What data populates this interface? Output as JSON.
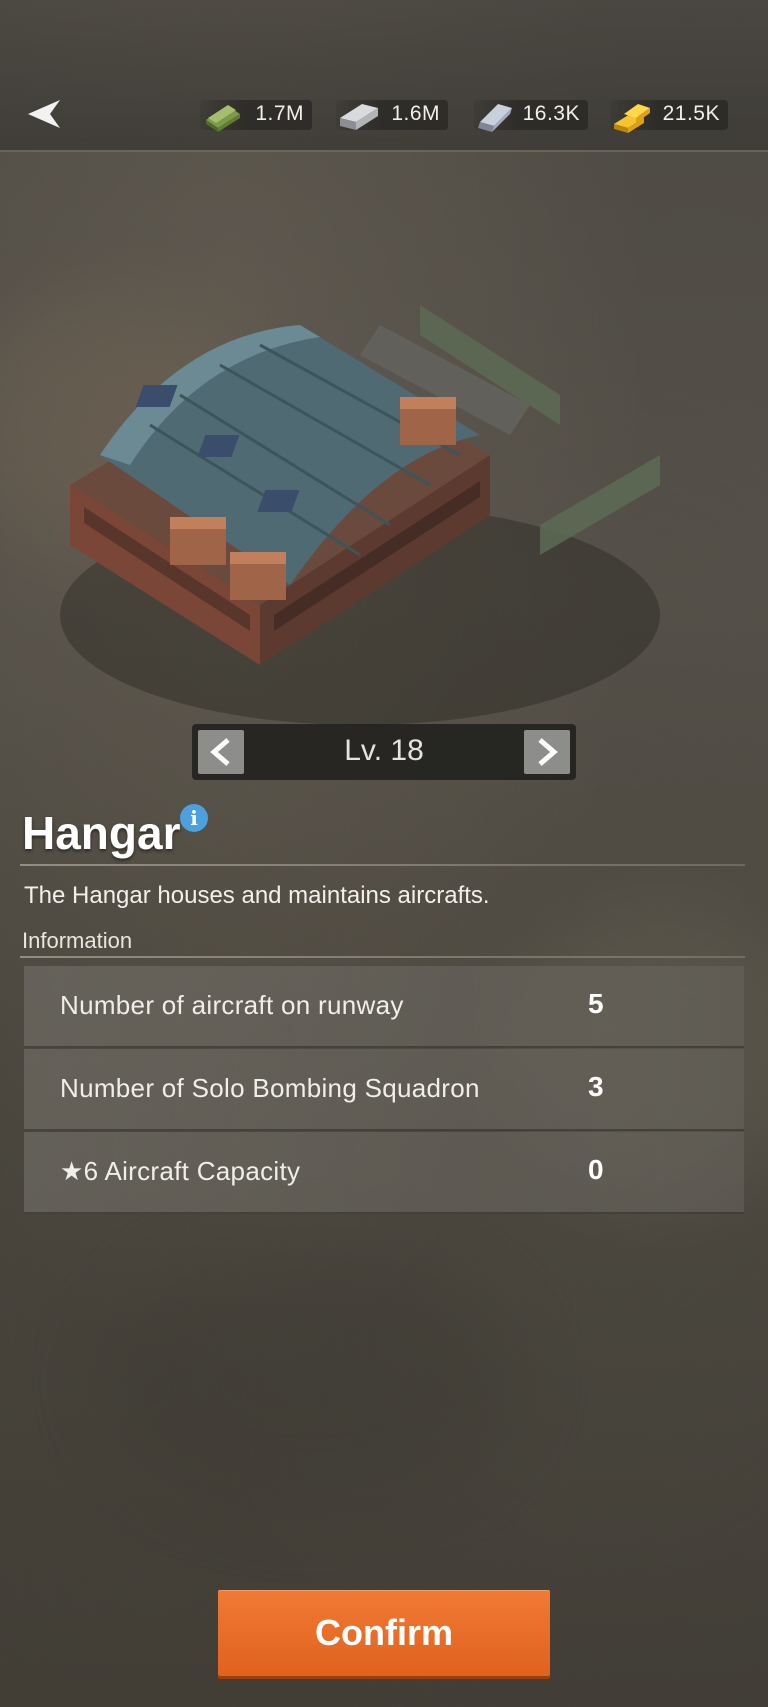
{
  "topbar": {
    "resources": [
      {
        "icon": "cash-bundle-icon",
        "value": "1.7M"
      },
      {
        "icon": "steel-ingot-icon",
        "value": "1.6M"
      },
      {
        "icon": "silver-ingot-icon",
        "value": "16.3K"
      },
      {
        "icon": "gold-bars-icon",
        "value": "21.5K"
      }
    ]
  },
  "building": {
    "level": "Lv. 18",
    "prev_label": "<",
    "next_label": ">"
  },
  "details": {
    "title": "Hangar",
    "info_glyph": "i",
    "description": "The Hangar houses and maintains aircrafts.",
    "section_label": "Information",
    "stats": [
      {
        "label": "Number of aircraft on runway",
        "value": "5"
      },
      {
        "label": "Number of Solo Bombing Squadron",
        "value": "3"
      },
      {
        "label": "★6 Aircraft Capacity",
        "value": "0"
      }
    ]
  },
  "actions": {
    "confirm_label": "Confirm"
  },
  "colors": {
    "confirm": "#e8692a",
    "info": "#4ba0dd"
  }
}
